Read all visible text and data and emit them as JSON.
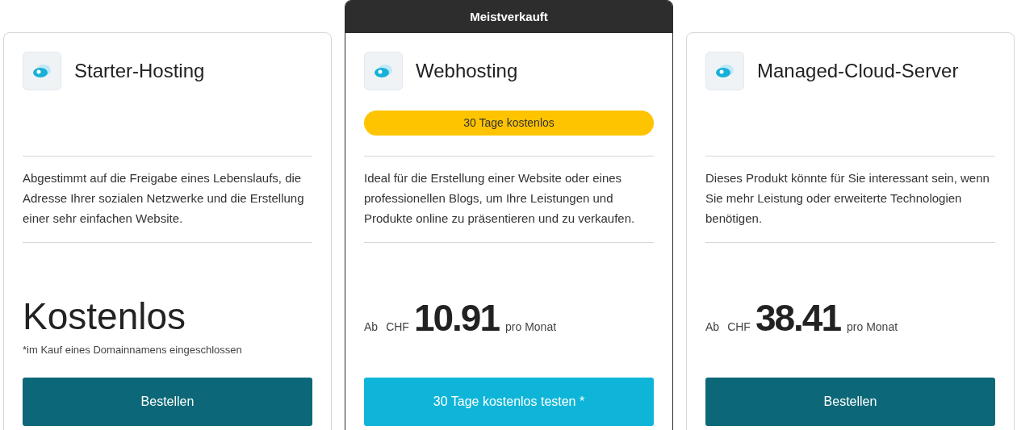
{
  "plans": [
    {
      "featured": false,
      "title": "Starter-Hosting",
      "description": "Abgestimmt auf die Freigabe eines Lebenslaufs, die Adresse Ihrer sozialen Netzwerke und die Erstellung einer sehr einfachen Website.",
      "price": {
        "kind": "free",
        "text": "Kostenlos",
        "footnote": "*im Kauf eines Domainnamens eingeschlossen"
      },
      "button": {
        "kind": "primary",
        "label": "Bestellen"
      }
    },
    {
      "featured": true,
      "ribbon": "Meistverkauft",
      "title": "Webhosting",
      "badge": "30 Tage kostenlos",
      "description": "Ideal für die Erstellung einer Website oder eines professionellen Blogs, um Ihre Leistungen und Produkte online zu präsentieren und zu verkaufen.",
      "price": {
        "kind": "amount",
        "prefix": "Ab",
        "currency": "CHF",
        "amount": "10.91",
        "period": "pro Monat"
      },
      "button": {
        "kind": "trial",
        "label": "30 Tage kostenlos testen *"
      }
    },
    {
      "featured": false,
      "title": "Managed-Cloud-Server",
      "description": "Dieses Produkt könnte für Sie interessant sein, wenn Sie mehr Leistung oder erweiterte Technologien benötigen.",
      "price": {
        "kind": "amount",
        "prefix": "Ab",
        "currency": "CHF",
        "amount": "38.41",
        "period": "pro Monat"
      },
      "button": {
        "kind": "primary",
        "label": "Bestellen"
      }
    }
  ]
}
